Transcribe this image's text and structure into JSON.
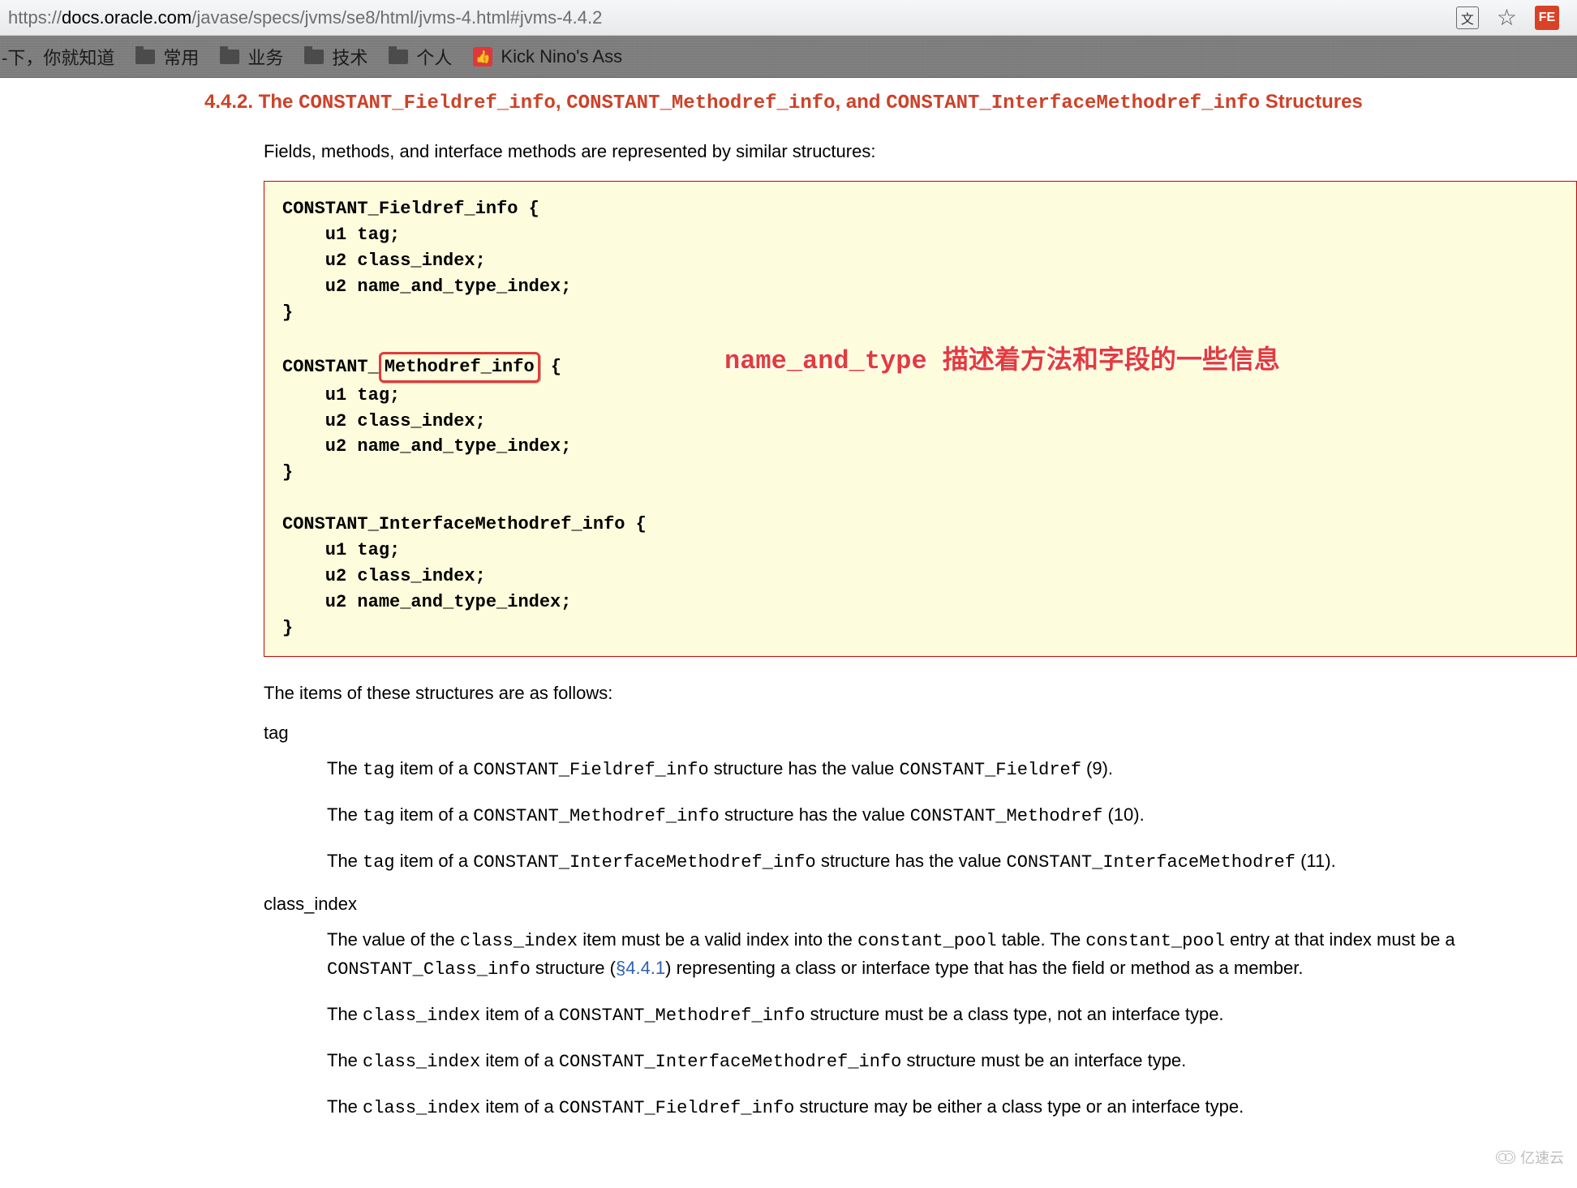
{
  "address_bar": {
    "url_proto": "https://",
    "url_host": "docs.oracle.com",
    "url_path": "/javase/specs/jvms/se8/html/jvms-4.html#jvms-4.4.2",
    "translate_icon": "translate-icon",
    "star_icon": "star-icon",
    "fe_badge": "FE"
  },
  "bookmarks": {
    "item0": "-下，你就知道",
    "item1": "常用",
    "item2": "业务",
    "item3": "技术",
    "item4": "个人",
    "item5": "Kick Nino's Ass"
  },
  "heading": {
    "prefix": "4.4.2. The ",
    "struct1": "CONSTANT_Fieldref_info",
    "sep1": ", ",
    "struct2": "CONSTANT_Methodref_info",
    "sep2": ", and ",
    "struct3": "CONSTANT_InterfaceMethodref_info",
    "suffix": " Structures"
  },
  "intro": "Fields, methods, and interface methods are represented by similar structures:",
  "code": {
    "b1l1": "CONSTANT_Fieldref_info {",
    "b1l2": "    u1 tag;",
    "b1l3": "    u2 class_index;",
    "b1l4": "    u2 name_and_type_index;",
    "b1l5": "}",
    "b2l1a": "CONSTANT_",
    "b2l1ring": "Methodref_info",
    "b2l1b": " {",
    "b2l2": "    u1 tag;",
    "b2l3": "    u2 class_index;",
    "b2l4": "    u2 name_and_type_index;",
    "b2l5": "}",
    "b3l1": "CONSTANT_InterfaceMethodref_info {",
    "b3l2": "    u1 tag;",
    "b3l3": "    u2 class_index;",
    "b3l4": "    u2 name_and_type_index;",
    "b3l5": "}"
  },
  "annotation": "name_and_type 描述着方法和字段的一些信息",
  "items_intro": "The items of these structures are as follows:",
  "dl": {
    "tag_term": "tag",
    "tag_d1_a": "The ",
    "tag_d1_b": "tag",
    "tag_d1_c": " item of a ",
    "tag_d1_d": "CONSTANT_Fieldref_info",
    "tag_d1_e": " structure has the value ",
    "tag_d1_f": "CONSTANT_Fieldref",
    "tag_d1_g": " (9).",
    "tag_d2_a": "The ",
    "tag_d2_b": "tag",
    "tag_d2_c": " item of a ",
    "tag_d2_d": "CONSTANT_Methodref_info",
    "tag_d2_e": " structure has the value ",
    "tag_d2_f": "CONSTANT_Methodref",
    "tag_d2_g": " (10).",
    "tag_d3_a": "The ",
    "tag_d3_b": "tag",
    "tag_d3_c": " item of a ",
    "tag_d3_d": "CONSTANT_InterfaceMethodref_info",
    "tag_d3_e": " structure has the value ",
    "tag_d3_f": "CONSTANT_InterfaceMethodref",
    "tag_d3_g": " (11).",
    "ci_term": "class_index",
    "ci_d1_a": "The value of the ",
    "ci_d1_b": "class_index",
    "ci_d1_c": " item must be a valid index into the ",
    "ci_d1_d": "constant_pool",
    "ci_d1_e": " table. The ",
    "ci_d1_f": "constant_pool",
    "ci_d1_g": " entry at that index must be a ",
    "ci_d1_h": "CONSTANT_Class_info",
    "ci_d1_i": " structure (",
    "ci_d1_link": "§4.4.1",
    "ci_d1_j": ") representing a class or interface type that has the field or method as a member.",
    "ci_d2_a": "The ",
    "ci_d2_b": "class_index",
    "ci_d2_c": " item of a ",
    "ci_d2_d": "CONSTANT_Methodref_info",
    "ci_d2_e": " structure must be a class type, not an interface type.",
    "ci_d3_a": "The ",
    "ci_d3_b": "class_index",
    "ci_d3_c": " item of a ",
    "ci_d3_d": "CONSTANT_InterfaceMethodref_info",
    "ci_d3_e": " structure must be an interface type.",
    "ci_d4_a": "The ",
    "ci_d4_b": "class_index",
    "ci_d4_c": " item of a ",
    "ci_d4_d": "CONSTANT_Fieldref_info",
    "ci_d4_e": " structure may be either a class type or an interface type."
  },
  "watermark": "亿速云"
}
